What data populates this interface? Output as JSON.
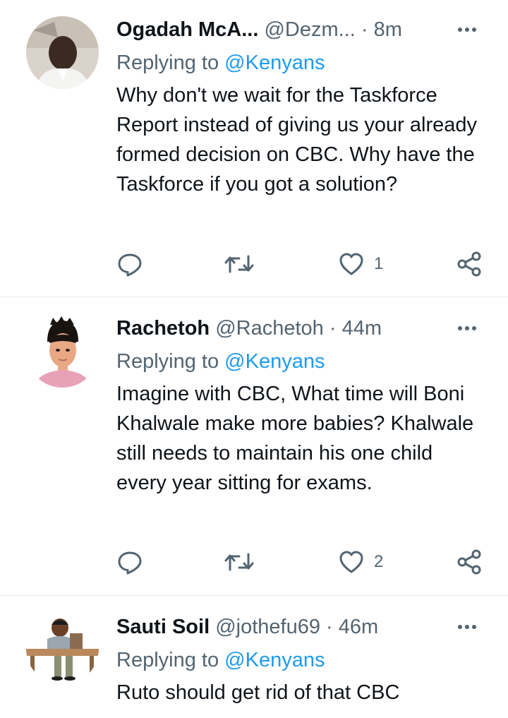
{
  "tweets": [
    {
      "name": "Ogadah McA...",
      "handle": "@Dezm...",
      "separator": "·",
      "time": "8m",
      "replying_prefix": "Replying to",
      "replying_to": "@Kenyans",
      "text": "Why don't we wait for the Taskforce Report instead of giving us your already formed decision on CBC. Why have the Taskforce if you got a solution?",
      "like_count": "1",
      "avatar_icon": "person-photo-avatar"
    },
    {
      "name": "Rachetoh",
      "handle": "@Rachetoh",
      "separator": "·",
      "time": "44m",
      "replying_prefix": "Replying to",
      "replying_to": "@Kenyans",
      "text": "Imagine with CBC, What time will Boni Khalwale make more babies? Khalwale still needs to maintain his one child every year sitting for exams.",
      "like_count": "2",
      "avatar_icon": "cartoon-avatar"
    },
    {
      "name": "Sauti Soil",
      "handle": "@jothefu69",
      "separator": "·",
      "time": "46m",
      "replying_prefix": "Replying to",
      "replying_to": "@Kenyans",
      "text": "Ruto should get rid of that CBC",
      "avatar_icon": "student-at-desk-avatar"
    }
  ],
  "colors": {
    "text": "#0f1419",
    "muted": "#536471",
    "link": "#1d9bf0",
    "divider": "#e6e9eb"
  }
}
